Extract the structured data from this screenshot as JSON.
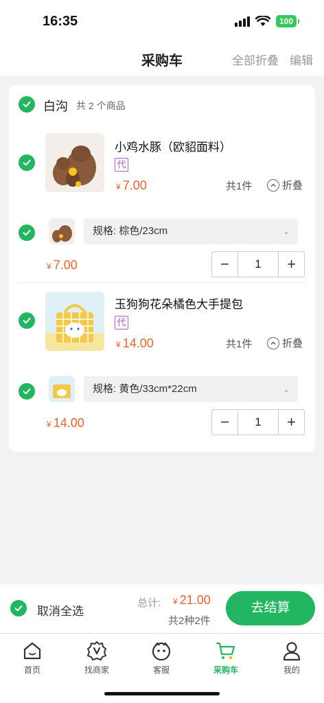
{
  "status": {
    "time": "16:35",
    "battery": "100"
  },
  "nav": {
    "title": "采购车",
    "collapse_all": "全部折叠",
    "edit": "编辑"
  },
  "shop": {
    "name": "白沟",
    "count": "共 2 个商品"
  },
  "products": [
    {
      "title": "小鸡水豚（欧貂面料）",
      "tag": "代",
      "price": "7.00",
      "currency": "¥",
      "total": "共1件",
      "fold": "折叠",
      "spec": "规格: 棕色/23cm",
      "sku_price": "7.00",
      "qty": "1"
    },
    {
      "title": "玉狗狗花朵橘色大手提包",
      "tag": "代",
      "price": "14.00",
      "currency": "¥",
      "total": "共1件",
      "fold": "折叠",
      "spec": "规格: 黄色/33cm*22cm",
      "sku_price": "14.00",
      "qty": "1"
    }
  ],
  "footer": {
    "deselect": "取消全选",
    "sum_label": "总计:",
    "currency": "¥",
    "sum_price": "21.00",
    "sum_count": "共2种2件",
    "checkout": "去结算"
  },
  "tabs": [
    {
      "label": "首页",
      "icon": "home-icon"
    },
    {
      "label": "找商家",
      "icon": "merchant-icon"
    },
    {
      "label": "客服",
      "icon": "service-icon"
    },
    {
      "label": "采购车",
      "icon": "cart-icon",
      "active": true
    },
    {
      "label": "我的",
      "icon": "profile-icon"
    }
  ],
  "colors": {
    "accent": "#23b662",
    "price": "#f0632b",
    "tag": "#b35ad6"
  }
}
